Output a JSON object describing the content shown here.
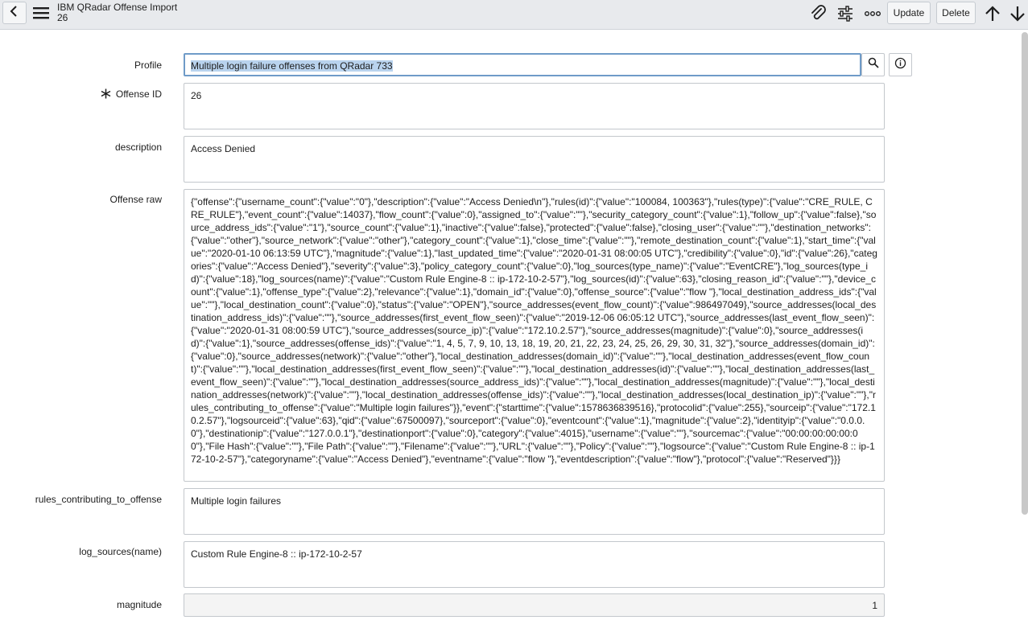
{
  "header": {
    "title": "IBM QRadar Offense Import",
    "subtitle": "26",
    "update_label": "Update",
    "delete_label": "Delete"
  },
  "form": {
    "profile": {
      "label": "Profile",
      "value": "Multiple login failure offenses from QRadar 733"
    },
    "offense_id": {
      "label": "Offense ID",
      "value": "26"
    },
    "description": {
      "label": "description",
      "value": "Access Denied"
    },
    "offense_raw": {
      "label": "Offense raw",
      "value": "{\"offense\":{\"username_count\":{\"value\":\"0\"},\"description\":{\"value\":\"Access Denied\\n\"},\"rules(id)\":{\"value\":\"100084, 100363\"},\"rules(type)\":{\"value\":\"CRE_RULE, CRE_RULE\"},\"event_count\":{\"value\":14037},\"flow_count\":{\"value\":0},\"assigned_to\":{\"value\":\"\"},\"security_category_count\":{\"value\":1},\"follow_up\":{\"value\":false},\"source_address_ids\":{\"value\":\"1\"},\"source_count\":{\"value\":1},\"inactive\":{\"value\":false},\"protected\":{\"value\":false},\"closing_user\":{\"value\":\"\"},\"destination_networks\":{\"value\":\"other\"},\"source_network\":{\"value\":\"other\"},\"category_count\":{\"value\":1},\"close_time\":{\"value\":\"\"},\"remote_destination_count\":{\"value\":1},\"start_time\":{\"value\":\"2020-01-10 06:13:59 UTC\"},\"magnitude\":{\"value\":1},\"last_updated_time\":{\"value\":\"2020-01-31 08:00:05 UTC\"},\"credibility\":{\"value\":0},\"id\":{\"value\":26},\"categories\":{\"value\":\"Access Denied\"},\"severity\":{\"value\":3},\"policy_category_count\":{\"value\":0},\"log_sources(type_name)\":{\"value\":\"EventCRE\"},\"log_sources(type_id)\":{\"value\":18},\"log_sources(name)\":{\"value\":\"Custom Rule Engine-8 :: ip-172-10-2-57\"},\"log_sources(id)\":{\"value\":63},\"closing_reason_id\":{\"value\":\"\"},\"device_count\":{\"value\":1},\"offense_type\":{\"value\":2},\"relevance\":{\"value\":1},\"domain_id\":{\"value\":0},\"offense_source\":{\"value\":\"flow \"},\"local_destination_address_ids\":{\"value\":\"\"},\"local_destination_count\":{\"value\":0},\"status\":{\"value\":\"OPEN\"},\"source_addresses(event_flow_count)\":{\"value\":986497049},\"source_addresses(local_destination_address_ids)\":{\"value\":\"\"},\"source_addresses(first_event_flow_seen)\":{\"value\":\"2019-12-06 06:05:12 UTC\"},\"source_addresses(last_event_flow_seen)\":{\"value\":\"2020-01-31 08:00:59 UTC\"},\"source_addresses(source_ip)\":{\"value\":\"172.10.2.57\"},\"source_addresses(magnitude)\":{\"value\":0},\"source_addresses(id)\":{\"value\":1},\"source_addresses(offense_ids)\":{\"value\":\"1, 4, 5, 7, 9, 10, 13, 18, 19, 20, 21, 22, 23, 24, 25, 26, 29, 30, 31, 32\"},\"source_addresses(domain_id)\":{\"value\":0},\"source_addresses(network)\":{\"value\":\"other\"},\"local_destination_addresses(domain_id)\":{\"value\":\"\"},\"local_destination_addresses(event_flow_count)\":{\"value\":\"\"},\"local_destination_addresses(first_event_flow_seen)\":{\"value\":\"\"},\"local_destination_addresses(id)\":{\"value\":\"\"},\"local_destination_addresses(last_event_flow_seen)\":{\"value\":\"\"},\"local_destination_addresses(source_address_ids)\":{\"value\":\"\"},\"local_destination_addresses(magnitude)\":{\"value\":\"\"},\"local_destination_addresses(network)\":{\"value\":\"\"},\"local_destination_addresses(offense_ids)\":{\"value\":\"\"},\"local_destination_addresses(local_destination_ip)\":{\"value\":\"\"},\"rules_contributing_to_offense\":{\"value\":\"Multiple login failures\"}},\"event\":{\"starttime\":{\"value\":1578636839516},\"protocolid\":{\"value\":255},\"sourceip\":{\"value\":\"172.10.2.57\"},\"logsourceid\":{\"value\":63},\"qid\":{\"value\":67500097},\"sourceport\":{\"value\":0},\"eventcount\":{\"value\":1},\"magnitude\":{\"value\":2},\"identityip\":{\"value\":\"0.0.0.0\"},\"destinationip\":{\"value\":\"127.0.0.1\"},\"destinationport\":{\"value\":0},\"category\":{\"value\":4015},\"username\":{\"value\":\"\"},\"sourcemac\":{\"value\":\"00:00:00:00:00:00\"},\"File Hash\":{\"value\":\"\"},\"File Path\":{\"value\":\"\"},\"Filename\":{\"value\":\"\"},\"URL\":{\"value\":\"\"},\"Policy\":{\"value\":\"\"},\"logsource\":{\"value\":\"Custom Rule Engine-8 :: ip-172-10-2-57\"},\"categoryname\":{\"value\":\"Access Denied\"},\"eventname\":{\"value\":\"flow \"},\"eventdescription\":{\"value\":\"flow\"},\"protocol\":{\"value\":\"Reserved\"}}}"
    },
    "rules_contributing": {
      "label": "rules_contributing_to_offense",
      "value": "Multiple login failures"
    },
    "log_sources_name": {
      "label": "log_sources(name)",
      "value": "Custom Rule Engine-8 :: ip-172-10-2-57"
    },
    "magnitude": {
      "label": "magnitude",
      "value": "1"
    }
  }
}
